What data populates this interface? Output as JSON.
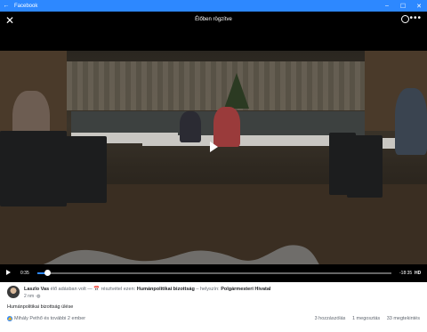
{
  "window": {
    "title": "Facebook",
    "back_icon": "arrow-left-icon",
    "buttons": [
      "minimize-icon",
      "maximize-icon",
      "close-icon"
    ]
  },
  "top_bar": {
    "close_icon": "close-icon",
    "status": "Élőben rögzítve",
    "messenger_icon": "messenger-icon",
    "more_icon": "more-icon"
  },
  "video": {
    "play_icon": "play-icon",
    "progress": 0.03
  },
  "controls": {
    "current_time": "0:35",
    "remaining_time": "-18:35",
    "quality": "HD"
  },
  "post": {
    "author": "Laszlo Vas",
    "action": "élő adásban volt —",
    "event_prefix": "📅 résztvétel ezen:",
    "event": "Humánpolitikai bizottság",
    "place_prefix": "– helyszín:",
    "place": "Polgármesteri Hivatal",
    "time": "2 nm",
    "caption": "Humánpolitikai bizottság ülése",
    "likers": "Mihály Pethő és további 2 ember",
    "comments": "3 hozzászólás",
    "shares": "1 megosztás",
    "views": "33 megtekintés"
  }
}
